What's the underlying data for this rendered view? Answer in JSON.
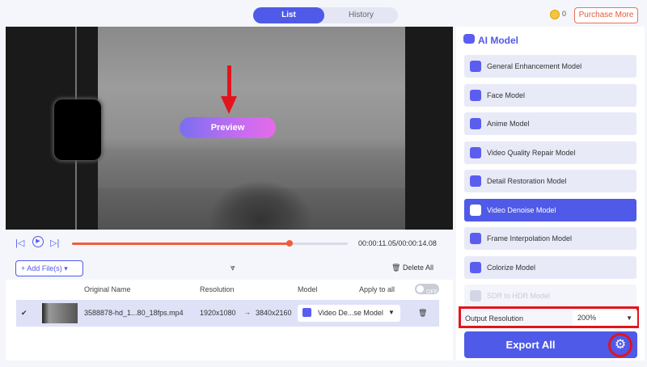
{
  "tabs": {
    "list": "List",
    "history": "History"
  },
  "header": {
    "coin_count": "0",
    "purchase_label": "Purchase More"
  },
  "video": {
    "preview_label": "Preview"
  },
  "player": {
    "time": "00:00:11.05/00:00:14.08",
    "progress_fraction": 0.79
  },
  "filebar": {
    "add_files_label": "Add File(s)",
    "delete_all_label": "Delete All"
  },
  "list": {
    "headers": {
      "name": "Original Name",
      "resolution": "Resolution",
      "model": "Model",
      "apply_all": "Apply to all",
      "toggle": "OFF"
    },
    "rows": [
      {
        "name": "3588878-hd_1...80_18fps.mp4",
        "res_from": "1920x1080",
        "arrow": "→",
        "res_to": "3840x2160",
        "model": "Video De...se Model"
      }
    ]
  },
  "sidebar": {
    "title": "AI Model",
    "models": [
      {
        "label": "General Enhancement Model",
        "state": "normal"
      },
      {
        "label": "Face Model",
        "state": "normal"
      },
      {
        "label": "Anime Model",
        "state": "normal"
      },
      {
        "label": "Video Quality Repair Model",
        "state": "normal"
      },
      {
        "label": "Detail Restoration Model",
        "state": "normal"
      },
      {
        "label": "Video Denoise Model",
        "state": "active"
      },
      {
        "label": "Frame Interpolation Model",
        "state": "normal"
      },
      {
        "label": "Colorize Model",
        "state": "normal"
      },
      {
        "label": "SDR to HDR Model",
        "state": "disabled"
      }
    ],
    "output_resolution_label": "Output Resolution",
    "output_resolution_value": "200%",
    "export_label": "Export All"
  }
}
